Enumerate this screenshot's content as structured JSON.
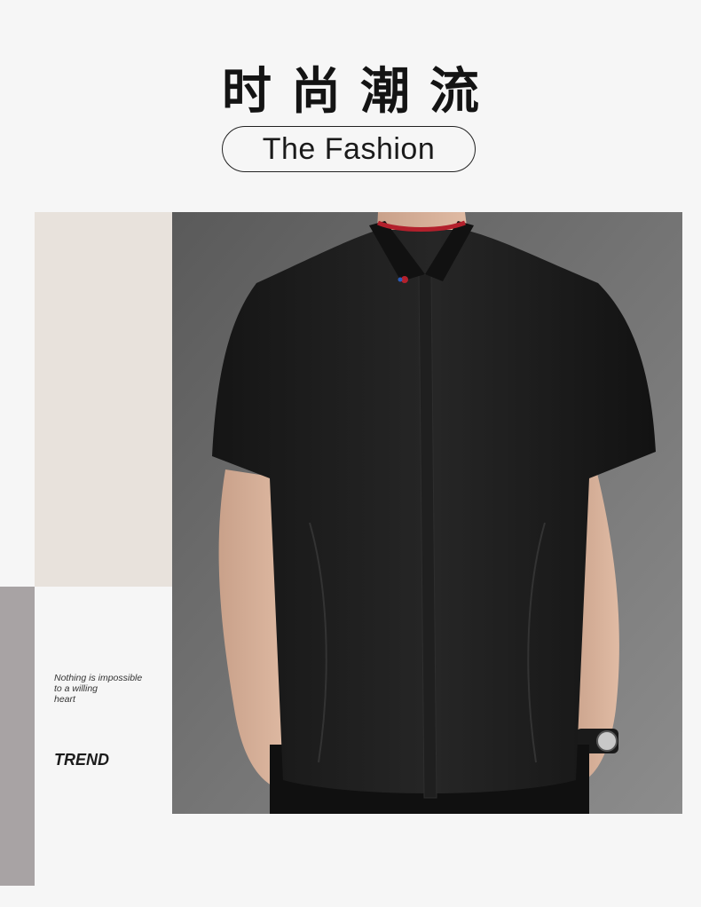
{
  "header": {
    "title_cn": "时尚潮流",
    "title_en": "The Fashion"
  },
  "side": {
    "tagline_line1": "Nothing is impossible",
    "tagline_line2": "to a willing",
    "tagline_line3": "heart",
    "label": "TREND"
  },
  "colors": {
    "background": "#f6f6f6",
    "beige_block": "#e8e2dc",
    "gray_block": "#a8a3a4",
    "shirt": "#1b1b1b",
    "collar_accent": "#b3202c"
  },
  "photo": {
    "subject": "man-in-black-short-sleeve-shirt"
  }
}
